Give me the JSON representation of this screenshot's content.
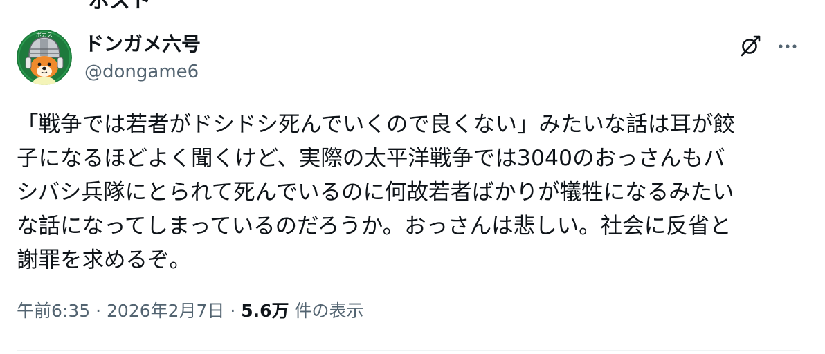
{
  "top_cut_text": "ポスト",
  "tweet": {
    "author": {
      "display_name": "ドンガメ六号",
      "handle": "@dongame6",
      "avatar_icon": "helmet-dog-avatar",
      "avatar_text": "ボカス"
    },
    "actions": {
      "grok_icon": "grok-icon",
      "more_icon": "more-horizontal-icon",
      "more_label": "···"
    },
    "text_lines": [
      "「戦争では若者がドシドシ死んでいくので良くない」みたいな話は耳が餃",
      "子になるほどよく聞くけど、実際の太平洋戦争では3040のおっさんもバ",
      "シバシ兵隊にとられて死んでいるのに何故若者ばかりが犠牲になるみたい",
      "な話になってしまっているのだろうか。おっさんは悲しい。社会に反省と",
      "謝罪を求めるぞ。"
    ],
    "meta": {
      "time": "午前6:35",
      "separator": " · ",
      "date": "2026年2月7日",
      "views_count": "5.6万",
      "views_label": " 件の表示"
    }
  },
  "colors": {
    "text_primary": "#0f1419",
    "text_secondary": "#536471",
    "divider": "#eff3f4",
    "avatar_bg": "#1e7a3c",
    "avatar_dog": "#f08a2c"
  }
}
